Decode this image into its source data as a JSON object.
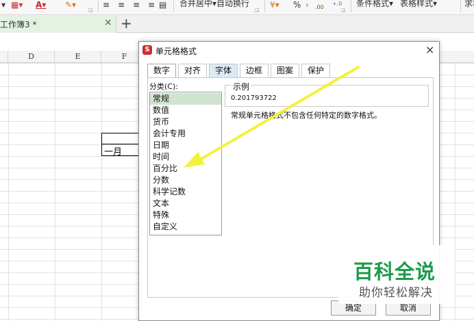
{
  "ribbon": {
    "merge_center": "合并居中",
    "wrap_text": "自动换行",
    "percent": "%",
    "dec_inc": ".00",
    "dec_inc2": "+.0",
    "cond_format": "条件格式",
    "table_style": "表格样式",
    "sum_partial": "求和"
  },
  "tab_bar": {
    "document_tab": "工作簿3 *",
    "close_symbol": "×",
    "new_tab_symbol": "+"
  },
  "sheet": {
    "column_headers": [
      "D",
      "E",
      "F"
    ],
    "cell_text": "一月"
  },
  "dialog": {
    "title": "单元格格式",
    "close_symbol": "×",
    "tabs": [
      "数字",
      "对齐",
      "字体",
      "边框",
      "图案",
      "保护"
    ],
    "category_label": "分类(C):",
    "categories": [
      "常规",
      "数值",
      "货币",
      "会计专用",
      "日期",
      "时间",
      "百分比",
      "分数",
      "科学记数",
      "文本",
      "特殊",
      "自定义"
    ],
    "sample_label": "示例",
    "sample_value": "0.201793722",
    "description": "常规单元格格式不包含任何特定的数字格式。",
    "ok_button": "确定",
    "cancel_button": "取消"
  },
  "watermark": {
    "main": "百科全说",
    "sub": "助你轻松解决"
  },
  "colors": {
    "arrow": "#f2f23c",
    "selected_category": "#cfe4cf",
    "watermark_green": "#1d9b4b",
    "doc_tab": "#e3f2e3"
  }
}
